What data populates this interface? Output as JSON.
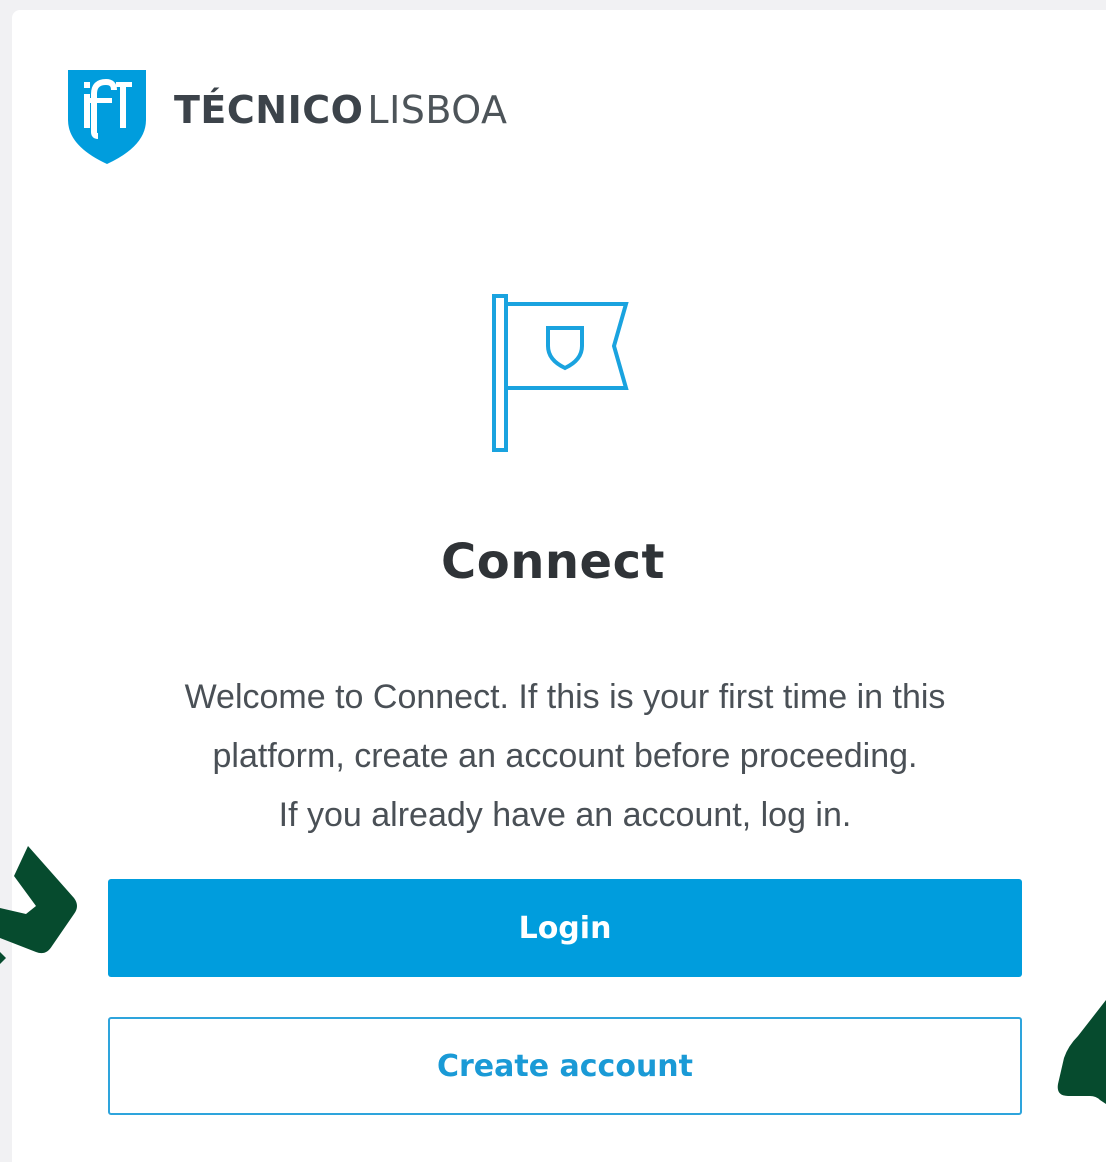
{
  "brand": {
    "logo_icon": "ist-shield-icon",
    "name_bold": "TÉCNICO",
    "name_light": "LISBOA"
  },
  "hero": {
    "icon": "flag-icon"
  },
  "title": "Connect",
  "description": {
    "line1": "Welcome to Connect. If this is your first time in this",
    "line2": "platform, create an account before proceeding.",
    "line3": "If you already have an account, log in."
  },
  "buttons": {
    "login_label": "Login",
    "create_label": "Create account"
  },
  "colors": {
    "primary": "#009ddd",
    "arrow": "#064b2e",
    "text": "#2f3337"
  }
}
